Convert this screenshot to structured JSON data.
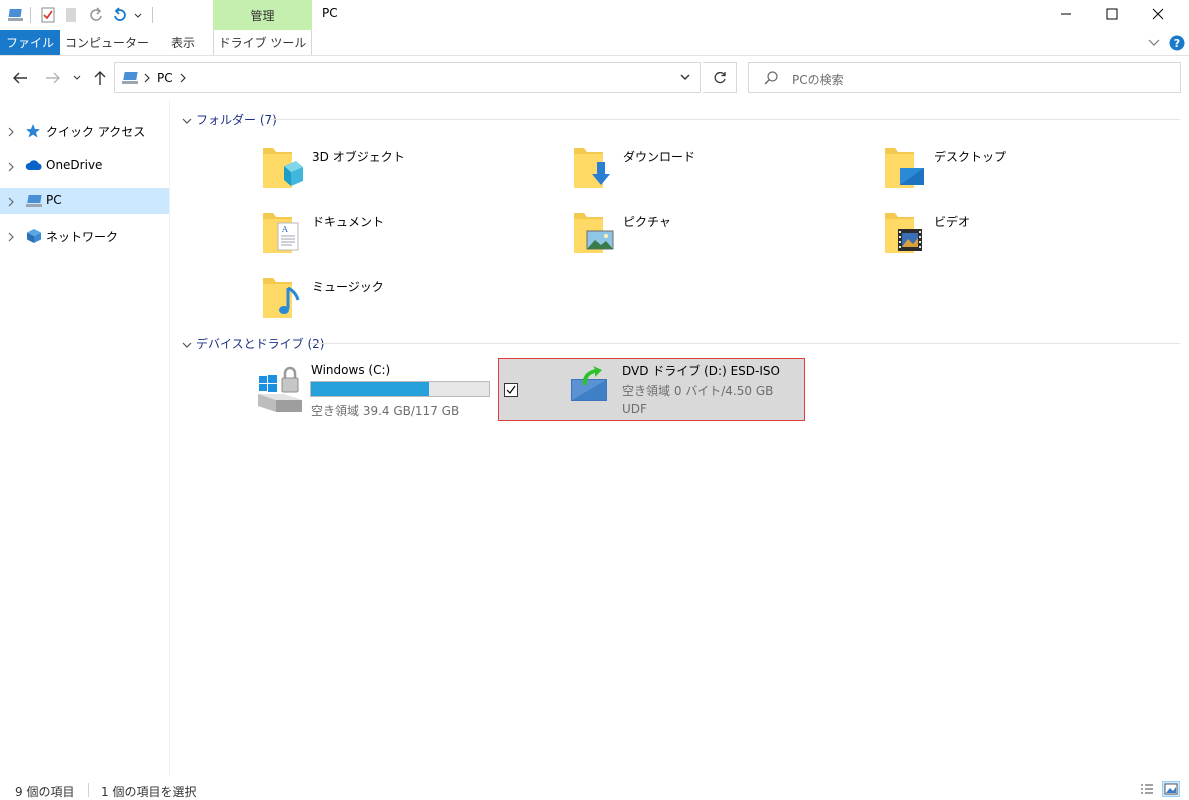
{
  "window": {
    "title": "PC",
    "context_tab": "管理",
    "colors": {
      "accent": "#1979ca",
      "context_tab": "#c5efae",
      "selection": "#cce8ff",
      "highlight_border": "#e03c3c",
      "capacity_bar": "#26a0da"
    }
  },
  "ribbon": {
    "tabs": [
      {
        "label": "ファイル"
      },
      {
        "label": "コンピューター"
      },
      {
        "label": "表示"
      },
      {
        "label": "ドライブ ツール"
      }
    ]
  },
  "address": {
    "crumbs": [
      "PC"
    ],
    "search_placeholder": "PCの検索"
  },
  "sidebar": {
    "items": [
      {
        "label": "クイック アクセス",
        "icon": "star-icon"
      },
      {
        "label": "OneDrive",
        "icon": "cloud-icon"
      },
      {
        "label": "PC",
        "icon": "pc-icon",
        "selected": true
      },
      {
        "label": "ネットワーク",
        "icon": "network-icon"
      }
    ]
  },
  "content": {
    "folders_group": {
      "title": "フォルダー (7)",
      "items": [
        {
          "label": "3D オブジェクト",
          "icon": "3d-objects-folder-icon"
        },
        {
          "label": "ダウンロード",
          "icon": "downloads-folder-icon"
        },
        {
          "label": "デスクトップ",
          "icon": "desktop-folder-icon"
        },
        {
          "label": "ドキュメント",
          "icon": "documents-folder-icon"
        },
        {
          "label": "ピクチャ",
          "icon": "pictures-folder-icon"
        },
        {
          "label": "ビデオ",
          "icon": "videos-folder-icon"
        },
        {
          "label": "ミュージック",
          "icon": "music-folder-icon"
        }
      ]
    },
    "devices_group": {
      "title": "デバイスとドライブ (2)",
      "drives": [
        {
          "name": "Windows (C:)",
          "free_text": "空き領域 39.4 GB/117 GB",
          "used_fraction": 0.663,
          "icon": "windows-drive-icon"
        },
        {
          "name": "DVD ドライブ (D:) ESD-ISO",
          "free_text": "空き領域 0 バイト/4.50 GB",
          "filesystem": "UDF",
          "icon": "dvd-drive-icon",
          "selected": true
        }
      ]
    }
  },
  "status": {
    "item_count": "9 個の項目",
    "selected_count": "1 個の項目を選択"
  }
}
